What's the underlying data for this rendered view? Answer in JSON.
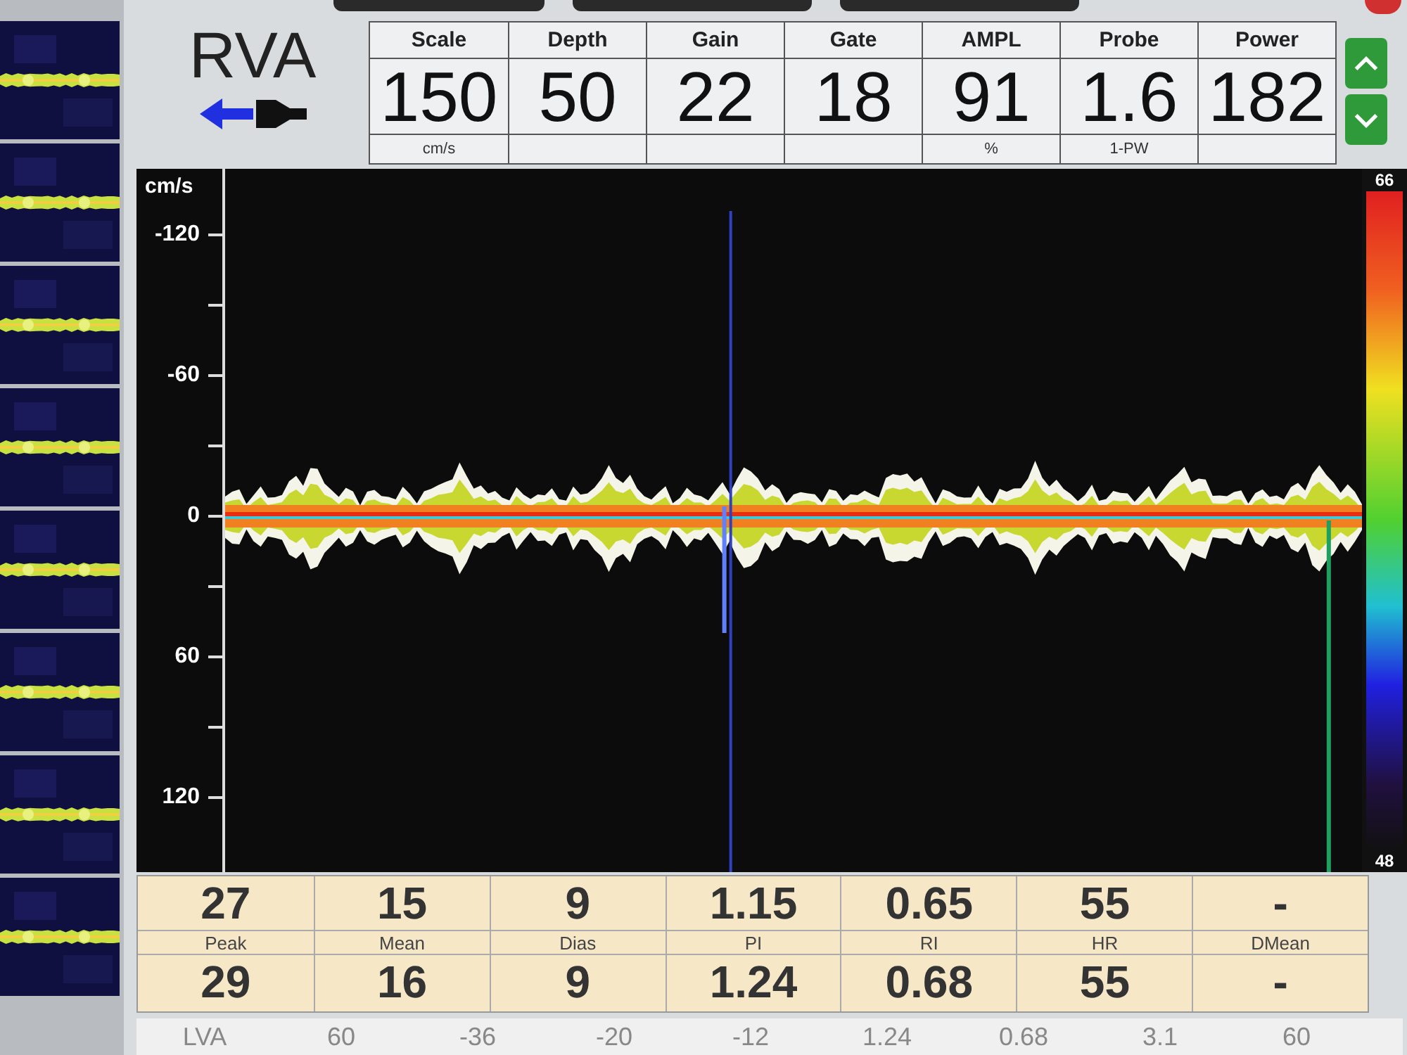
{
  "header": {
    "title": "RVA"
  },
  "parameters": [
    {
      "label": "Scale",
      "value": "150",
      "unit": "cm/s"
    },
    {
      "label": "Depth",
      "value": "50"
    },
    {
      "label": "Gain",
      "value": "22"
    },
    {
      "label": "Gate",
      "value": "18"
    },
    {
      "label": "AMPL",
      "value": "91",
      "unit": "%"
    },
    {
      "label": "Probe",
      "value": "1.6",
      "unit": "1-PW"
    },
    {
      "label": "Power",
      "value": "182"
    }
  ],
  "spectrum": {
    "unit": "cm/s",
    "ticks": [
      "-120",
      "-60",
      "0",
      "60",
      "120"
    ],
    "colorbar_max": "66",
    "colorbar_min": "48"
  },
  "measurements": [
    {
      "label": "Peak",
      "current": "27",
      "previous": "29"
    },
    {
      "label": "Mean",
      "current": "15",
      "previous": "16"
    },
    {
      "label": "Dias",
      "current": "9",
      "previous": "9"
    },
    {
      "label": "PI",
      "current": "1.15",
      "previous": "1.24"
    },
    {
      "label": "RI",
      "current": "0.65",
      "previous": "0.68"
    },
    {
      "label": "HR",
      "current": "55",
      "previous": "55"
    },
    {
      "label": "DMean",
      "current": "-",
      "previous": "-"
    }
  ],
  "history_row": [
    "LVA",
    "60",
    "-36",
    "-20",
    "-12",
    "1.24",
    "0.68",
    "3.1",
    "60"
  ]
}
